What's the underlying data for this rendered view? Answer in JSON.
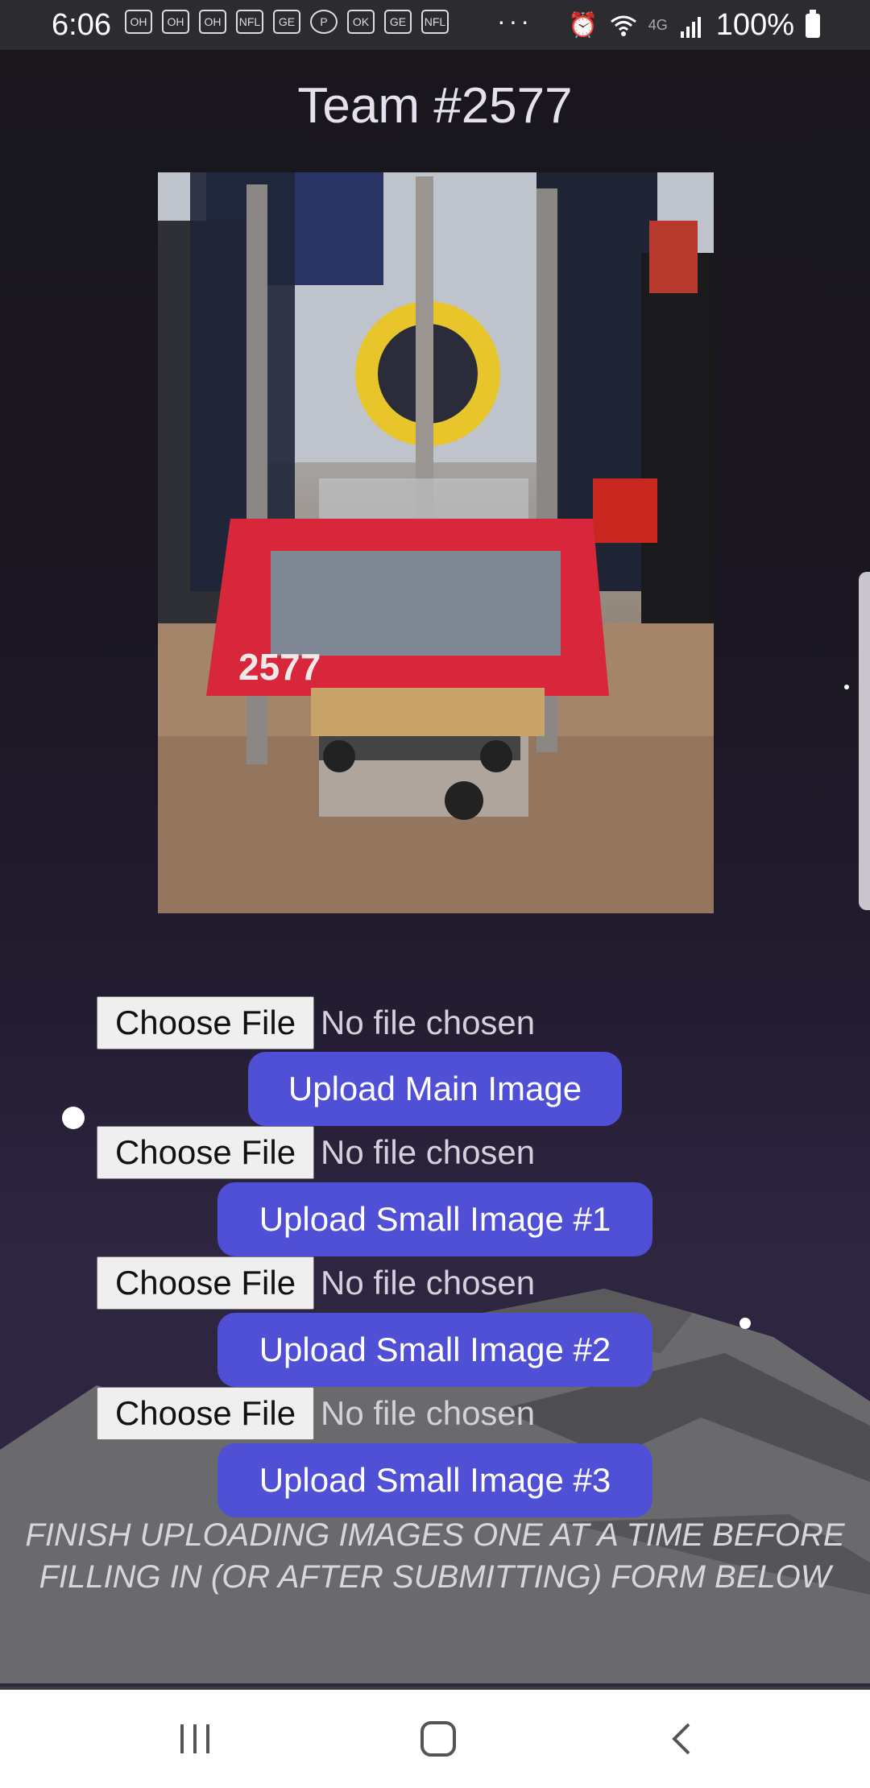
{
  "status_bar": {
    "time": "6:06",
    "notification_icons": [
      "OH",
      "OH",
      "OH",
      "NFL",
      "GE",
      "P",
      "OK",
      "GE",
      "NFL"
    ],
    "overflow": "···",
    "network_label": "4G",
    "battery": "100%"
  },
  "page": {
    "title": "Team #2577"
  },
  "uploads": [
    {
      "choose_label": "Choose File",
      "status": "No file chosen",
      "upload_label": "Upload Main Image"
    },
    {
      "choose_label": "Choose File",
      "status": "No file chosen",
      "upload_label": "Upload Small Image #1"
    },
    {
      "choose_label": "Choose File",
      "status": "No file chosen",
      "upload_label": "Upload Small Image #2"
    },
    {
      "choose_label": "Choose File",
      "status": "No file chosen",
      "upload_label": "Upload Small Image #3"
    }
  ],
  "notice": "FINISH UPLOADING IMAGES ONE AT A TIME BEFORE FILLING IN (OR AFTER SUBMITTING) FORM BELOW",
  "robot_photo": {
    "number_label": "2577"
  },
  "colors": {
    "upload_button": "#5050d6",
    "background_top": "#19171c",
    "background_bottom": "#302742"
  }
}
